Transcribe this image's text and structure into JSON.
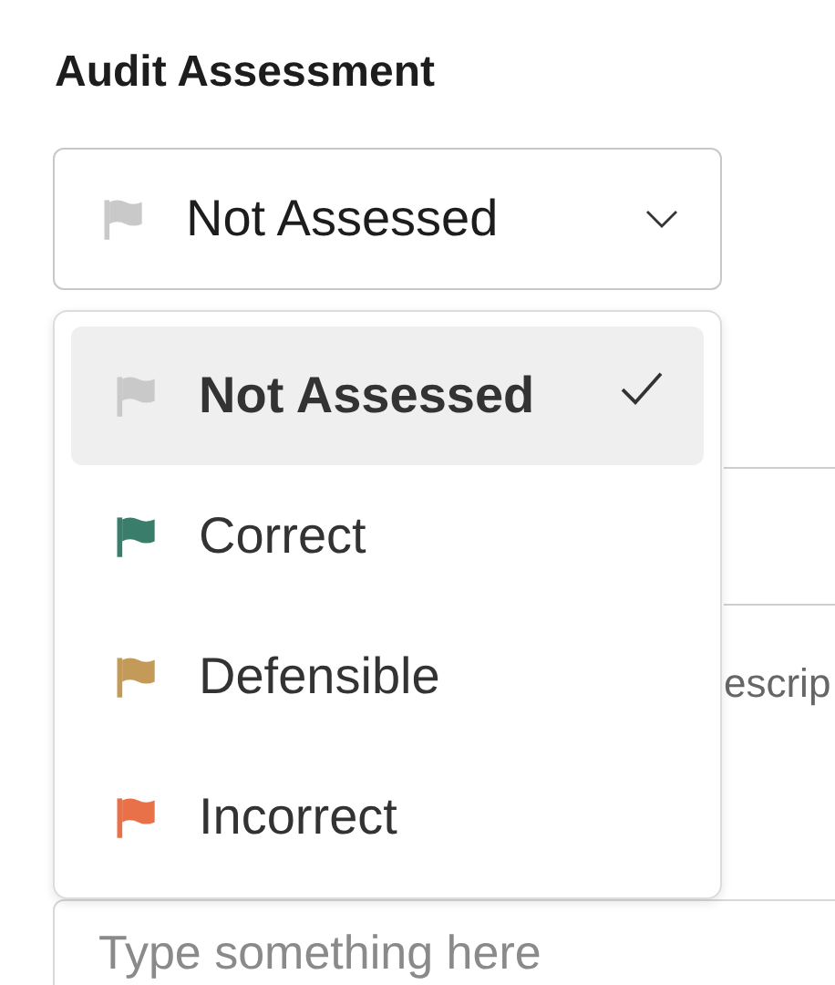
{
  "field": {
    "label": "Audit Assessment",
    "value": "Not Assessed",
    "open": true
  },
  "options": [
    {
      "label": "Not Assessed",
      "color": "#c9c9c9",
      "selected": true
    },
    {
      "label": "Correct",
      "color": "#3b7d6b",
      "selected": false
    },
    {
      "label": "Defensible",
      "color": "#c49a58",
      "selected": false
    },
    {
      "label": "Incorrect",
      "color": "#e8714a",
      "selected": false
    }
  ],
  "background": {
    "text_fragment": "escrip"
  },
  "comment": {
    "placeholder": "Type something here"
  }
}
